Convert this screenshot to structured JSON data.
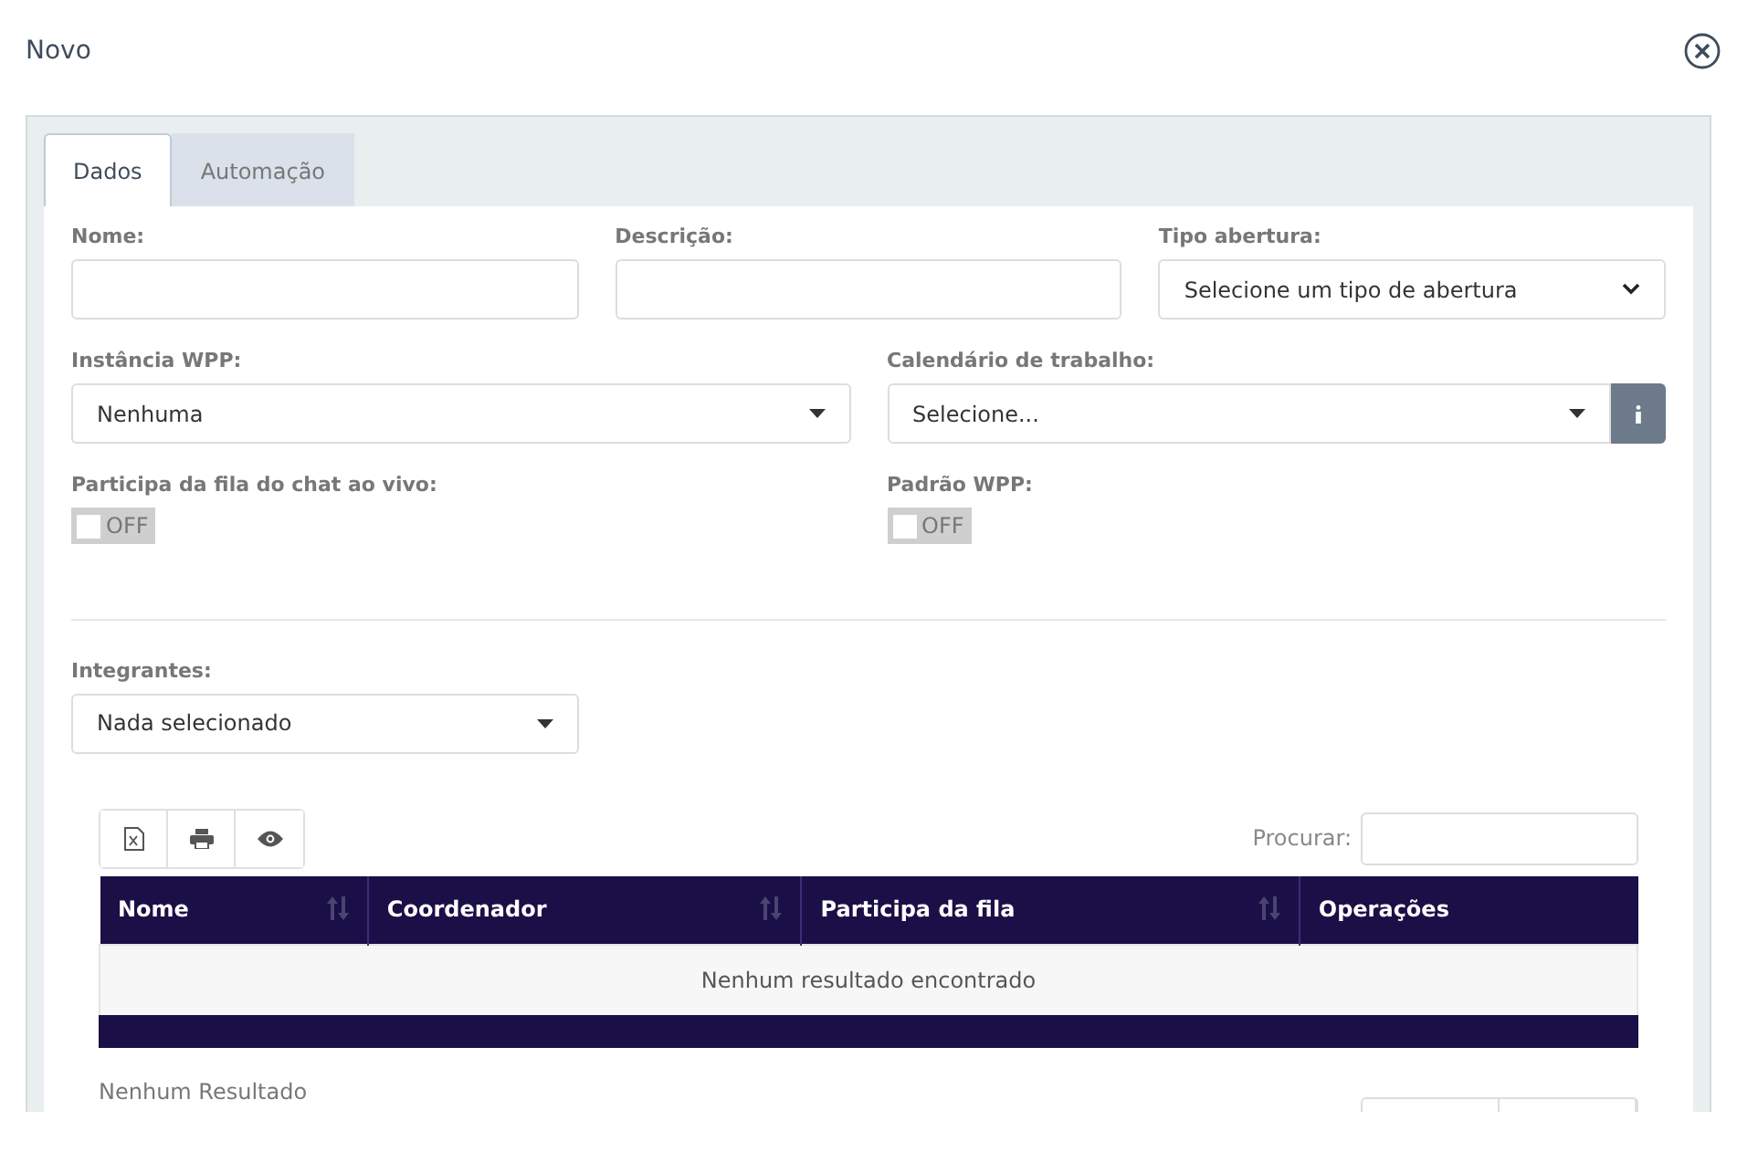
{
  "dialog": {
    "title": "Novo"
  },
  "tabs": [
    {
      "label": "Dados",
      "selected": true
    },
    {
      "label": "Automação",
      "selected": false
    }
  ],
  "form_rows": [
    [
      {
        "kind": "text",
        "label": "Nome:"
      },
      {
        "kind": "text",
        "label": "Descrição:"
      },
      {
        "kind": "native_select",
        "label": "Tipo abertura:",
        "value": "Selecione um tipo de abertura"
      }
    ],
    [
      {
        "kind": "select",
        "label": "Instância WPP:",
        "value": "Nenhuma"
      },
      {
        "kind": "select_info",
        "label": "Calendário de trabalho:",
        "value": "Selecione..."
      }
    ],
    [
      {
        "kind": "toggle",
        "label": "Participa da fila do chat ao vivo:",
        "state_label": "OFF",
        "on": false
      },
      {
        "kind": "toggle",
        "label": "Padrão WPP:",
        "state_label": "OFF",
        "on": false
      }
    ]
  ],
  "members": {
    "label": "Integrantes:",
    "value": "Nada selecionado"
  },
  "table": {
    "search_label": "Procurar:",
    "columns": [
      {
        "label": "Nome",
        "sortable": true
      },
      {
        "label": "Coordenador",
        "sortable": true
      },
      {
        "label": "Participa da fila",
        "sortable": true
      },
      {
        "label": "Operações",
        "sortable": false
      }
    ],
    "empty_message": "Nenhum resultado encontrado"
  },
  "result_info": "Nenhum Resultado"
}
